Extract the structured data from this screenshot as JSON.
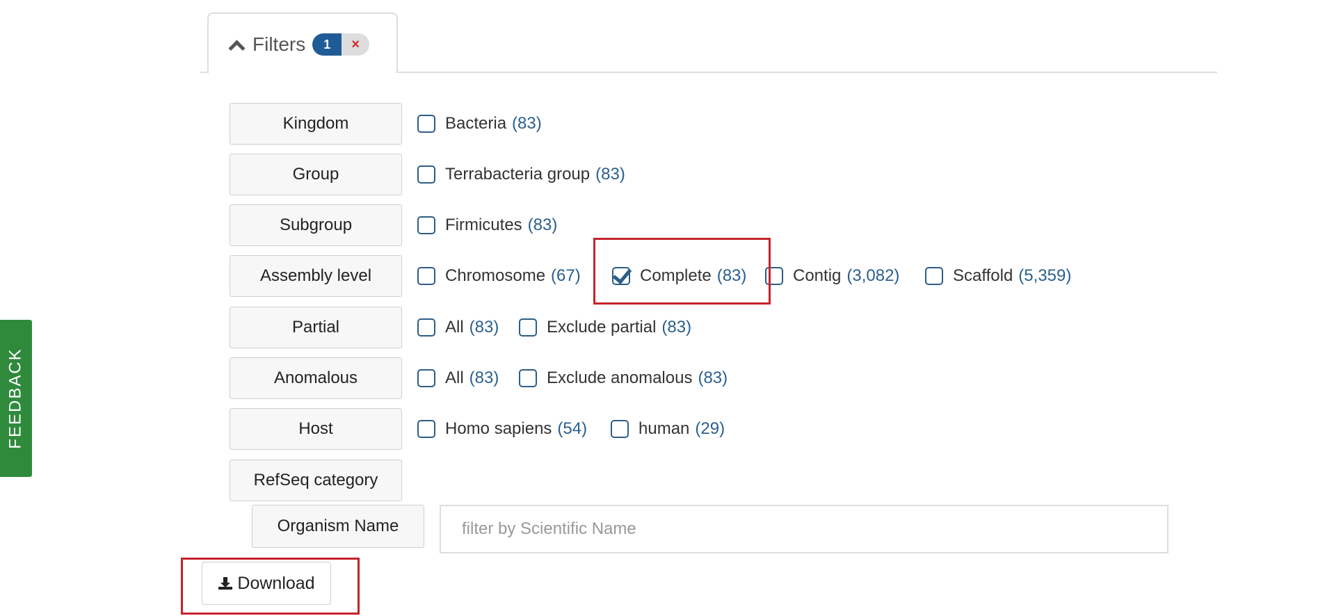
{
  "tab": {
    "title": "Filters",
    "active_count": "1",
    "clear_symbol": "×"
  },
  "facets": [
    {
      "label": "Kingdom",
      "options": [
        {
          "label": "Bacteria",
          "count": "(83)",
          "checked": false
        }
      ]
    },
    {
      "label": "Group",
      "options": [
        {
          "label": "Terrabacteria group",
          "count": "(83)",
          "checked": false
        }
      ]
    },
    {
      "label": "Subgroup",
      "options": [
        {
          "label": "Firmicutes",
          "count": "(83)",
          "checked": false
        }
      ]
    },
    {
      "label": "Assembly level",
      "options": [
        {
          "label": "Chromosome",
          "count": "(67)",
          "checked": false
        },
        {
          "label": "Complete",
          "count": "(83)",
          "checked": true
        },
        {
          "label": "Contig",
          "count": "(3,082)",
          "checked": false
        },
        {
          "label": "Scaffold",
          "count": "(5,359)",
          "checked": false
        }
      ]
    },
    {
      "label": "Partial",
      "options": [
        {
          "label": "All",
          "count": "(83)",
          "checked": false
        },
        {
          "label": "Exclude partial",
          "count": "(83)",
          "checked": false
        }
      ]
    },
    {
      "label": "Anomalous",
      "options": [
        {
          "label": "All",
          "count": "(83)",
          "checked": false
        },
        {
          "label": "Exclude anomalous",
          "count": "(83)",
          "checked": false
        }
      ]
    },
    {
      "label": "Host",
      "options": [
        {
          "label": "Homo sapiens",
          "count": "(54)",
          "checked": false
        },
        {
          "label": "human",
          "count": "(29)",
          "checked": false
        }
      ]
    },
    {
      "label": "RefSeq category",
      "options": []
    }
  ],
  "organism": {
    "label": "Organism Name",
    "placeholder": "filter by Scientific Name",
    "value": ""
  },
  "download": {
    "label": "Download"
  },
  "feedback": {
    "label": "FEEDBACK"
  },
  "colors": {
    "accent": "#1f5b96",
    "highlight": "#c5222c",
    "feedback_bg": "#2f8a3c",
    "count_text": "#2a5f8e"
  },
  "icons": {
    "tab_toggle": "chevron-up-icon",
    "clear": "close-icon",
    "download": "download-icon"
  }
}
